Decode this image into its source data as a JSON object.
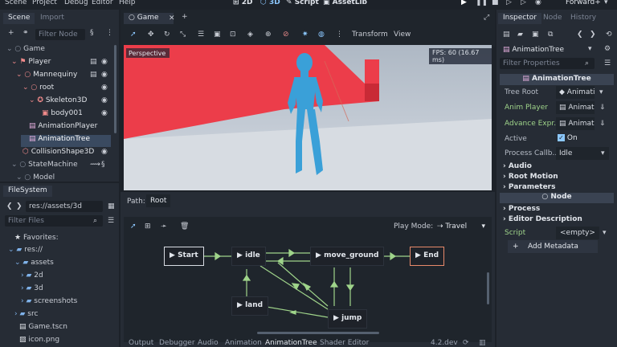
{
  "menu": {
    "items": [
      "Scene",
      "Project",
      "Debug",
      "Editor",
      "Help"
    ],
    "modes": [
      "2D",
      "3D",
      "Script",
      "AssetLib"
    ],
    "renderer": "Forward+"
  },
  "scene_dock": {
    "tabs": [
      "Scene",
      "Import"
    ],
    "filter_placeholder": "Filter Node",
    "tree": [
      {
        "label": "Game",
        "color": "#e0e3e8"
      },
      {
        "label": "Player",
        "color": "#f08a8a"
      },
      {
        "label": "Mannequiny",
        "color": "#f08a8a"
      },
      {
        "label": "root",
        "color": "#f08a8a"
      },
      {
        "label": "Skeleton3D",
        "color": "#f08a8a"
      },
      {
        "label": "body001",
        "color": "#f08a8a"
      },
      {
        "label": "AnimationPlayer",
        "color": "#e6b0e0"
      },
      {
        "label": "AnimationTree",
        "color": "#e6b0e0"
      },
      {
        "label": "CollisionShape3D",
        "color": "#f08a8a"
      },
      {
        "label": "StateMachine",
        "color": "#e0e3e8"
      },
      {
        "label": "Model",
        "color": "#e0e3e8"
      }
    ]
  },
  "filesystem": {
    "tab": "FileSystem",
    "path": "res://assets/3d",
    "filter_placeholder": "Filter Files",
    "items": [
      "Favorites:",
      "res://",
      "assets",
      "2d",
      "3d",
      "screenshots",
      "src",
      "Game.tscn",
      "icon.png"
    ]
  },
  "viewport": {
    "tab": "Game",
    "perspective": "Perspective",
    "fps": "FPS: 60 (16.67 ms)",
    "toolbar_labels": [
      "Transform",
      "View"
    ]
  },
  "anim_tree": {
    "path_label": "Path:",
    "path_value": "Root",
    "play_mode_label": "Play Mode:",
    "play_mode_value": "Travel",
    "nodes": [
      "Start",
      "idle",
      "move_ground",
      "End",
      "land",
      "jump"
    ]
  },
  "bottom_tabs": [
    "Output",
    "Debugger",
    "Audio",
    "Animation",
    "AnimationTree",
    "Shader Editor"
  ],
  "version": "4.2.dev",
  "inspector": {
    "tabs": [
      "Inspector",
      "Node",
      "History"
    ],
    "object": "AnimationTree",
    "filter_placeholder": "Filter Properties",
    "header": "AnimationTree",
    "props": [
      {
        "label": "Tree Root",
        "value": "Animati"
      },
      {
        "label": "Anim Player",
        "value": "Animati"
      },
      {
        "label": "Advance Expr...",
        "value": "Animati"
      },
      {
        "label": "Active",
        "value": "On"
      },
      {
        "label": "Process Callb...",
        "value": "Idle"
      }
    ],
    "sections": [
      "Audio",
      "Root Motion",
      "Parameters"
    ],
    "node_header": "Node",
    "node_sections": [
      "Process",
      "Editor Description"
    ],
    "script_label": "Script",
    "script_value": "<empty>",
    "add_metadata": "Add Metadata"
  }
}
